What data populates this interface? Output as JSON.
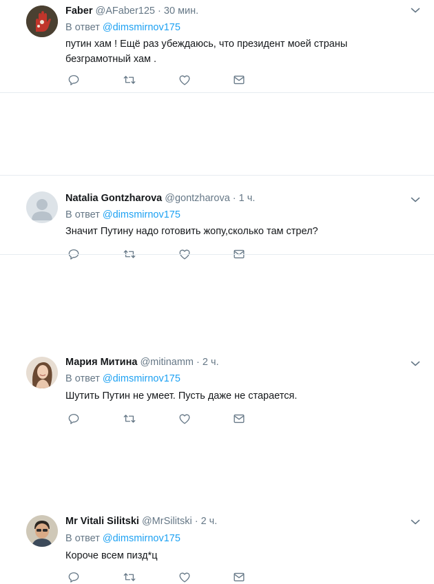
{
  "common": {
    "reply_prefix": "В ответ",
    "dot": "·"
  },
  "tweets": [
    {
      "name": "Faber",
      "handle": "@AFaber125",
      "time": "30 мин.",
      "reply_to": "@dimsmirnov175",
      "text": "путин хам ! Ещё раз убеждаюсь, что президент моей страны безграмотный хам .",
      "avatar": "hand-print-avatar"
    },
    {
      "name": "Natalia Gontzharova",
      "handle": "@gontzharova",
      "time": "1 ч.",
      "reply_to": "@dimsmirnov175",
      "text": "Значит Путину надо готовить жопу,сколько там стрел?",
      "avatar": "default-egg-avatar"
    },
    {
      "name": "Мария Митина",
      "handle": "@mitinamm",
      "time": "2 ч.",
      "reply_to": "@dimsmirnov175",
      "text": "Шутить Путин не умеет. Пусть даже не старается.",
      "avatar": "woman-photo-avatar"
    },
    {
      "name": "Mr Vitali Silitski",
      "handle": "@MrSilitski",
      "time": "2 ч.",
      "reply_to": "@dimsmirnov175",
      "text": "Короче всем пизд*ц",
      "avatar": "man-photo-avatar"
    }
  ],
  "icons": {
    "reply": "reply-icon",
    "retweet": "retweet-icon",
    "like": "heart-icon",
    "dm": "envelope-icon",
    "menu": "chevron-down-icon"
  },
  "colors": {
    "link": "#1da1f2",
    "muted": "#657786",
    "text": "#14171a",
    "divider": "#e6ecf0"
  }
}
